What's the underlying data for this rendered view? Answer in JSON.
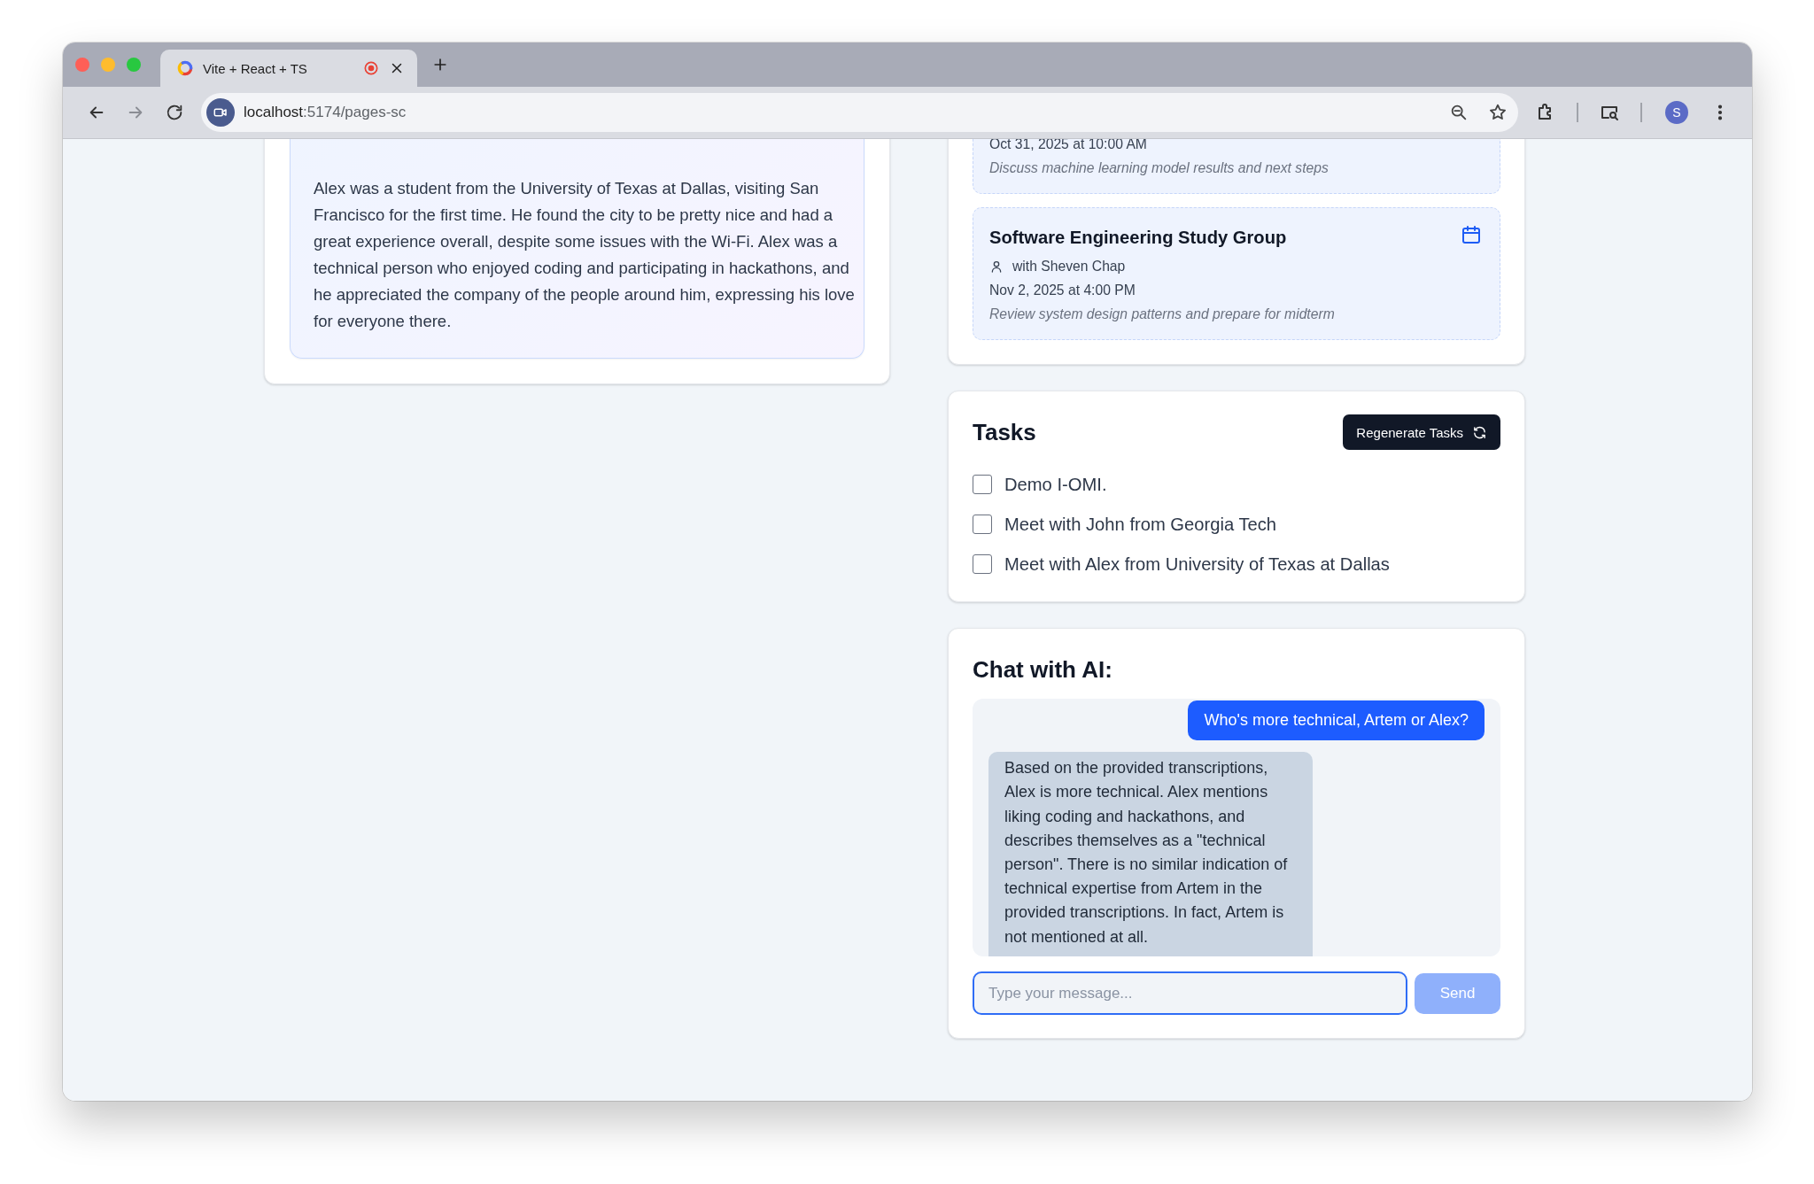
{
  "browser": {
    "tabs": [
      {
        "title": "Vite + React + TS",
        "selected": true,
        "recording": true
      }
    ],
    "address": {
      "host": "localhost",
      "path": ":5174/pages-sc"
    },
    "forward_disabled": true,
    "profile_initial": "S"
  },
  "summary": {
    "text": "Alex was a student from the University of Texas at Dallas, visiting San Francisco for the first time. He found the city to be pretty nice and had a great experience overall, despite some issues with the Wi-Fi. Alex was a technical person who enjoyed coding and participating in hackathons, and he appreciated the company of the people around him, expressing his love for everyone there."
  },
  "meetings": [
    {
      "date": "Oct 31, 2025 at 10:00 AM",
      "description": "Discuss machine learning model results and next steps"
    },
    {
      "title": "Software Engineering Study Group",
      "attendee": "with Sheven Chap",
      "date": "Nov 2, 2025 at 4:00 PM",
      "description": "Review system design patterns and prepare for midterm"
    }
  ],
  "tasks": {
    "title": "Tasks",
    "regenerate_button": "Regenerate Tasks",
    "items": [
      {
        "label": "Demo I-OMI.",
        "checked": false
      },
      {
        "label": "Meet with John from Georgia Tech",
        "checked": false
      },
      {
        "label": "Meet with Alex from University of Texas at Dallas",
        "checked": false
      }
    ]
  },
  "chat": {
    "title": "Chat with AI:",
    "messages": [
      {
        "kind": "user",
        "text": "Who's more technical, Artem or Alex?"
      },
      {
        "kind": "ai",
        "text": "Based on the provided transcriptions, Alex is more technical. Alex mentions liking coding and hackathons, and describes themselves as a \"technical person\". There is no similar indication of technical expertise from Artem in the provided transcriptions. In fact, Artem is not mentioned at all."
      }
    ],
    "input": {
      "placeholder": "Type your message...",
      "focused": true
    },
    "send_button": {
      "label": "Send",
      "disabled": true
    }
  }
}
